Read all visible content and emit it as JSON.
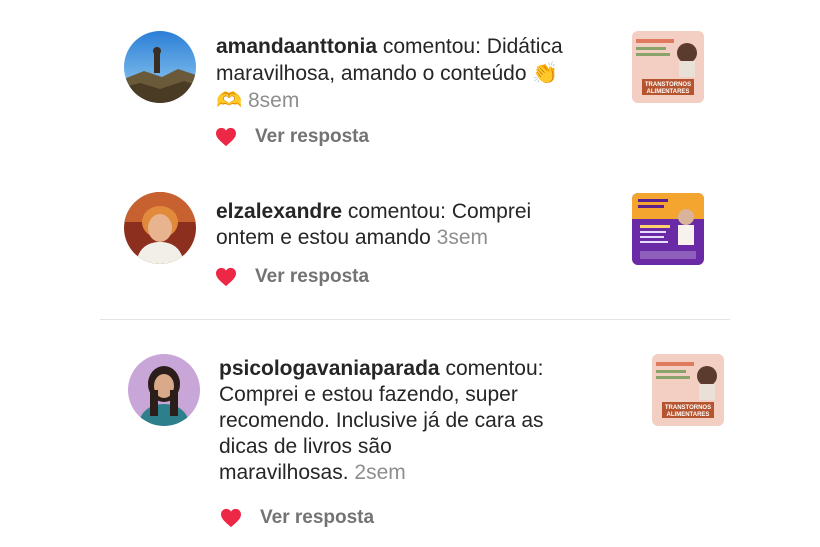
{
  "comments": [
    {
      "username": "amandaanttonia",
      "verb": "comentou:",
      "text_line1": "Didática",
      "text_line2": "maravilhosa, amando o conteúdo",
      "emoji1": "👏",
      "emoji2": "🫶",
      "time": "8sem",
      "reply_label": "Ver resposta",
      "thumb_lines": [
        "TRANSTORNOS",
        "ALIMENTARES"
      ]
    },
    {
      "username": "elzalexandre",
      "verb": "comentou:",
      "text_line1": "Comprei",
      "text_line2": "ontem e estou amando",
      "time": "3sem",
      "reply_label": "Ver resposta"
    },
    {
      "username": "psicologavaniaparada",
      "verb": "comentou:",
      "text_line2": "Comprei e estou fazendo, super",
      "text_line3": "recomendo. Inclusive já de cara as",
      "text_line4": "dicas de livros são",
      "text_line5": "maravilhosas.",
      "time": "2sem",
      "reply_label": "Ver resposta",
      "thumb_lines": [
        "TRANSTORNOS",
        "ALIMENTARES"
      ]
    }
  ],
  "colors": {
    "heart": "#ed2846",
    "muted": "#8e8e8e",
    "text": "#262626"
  }
}
